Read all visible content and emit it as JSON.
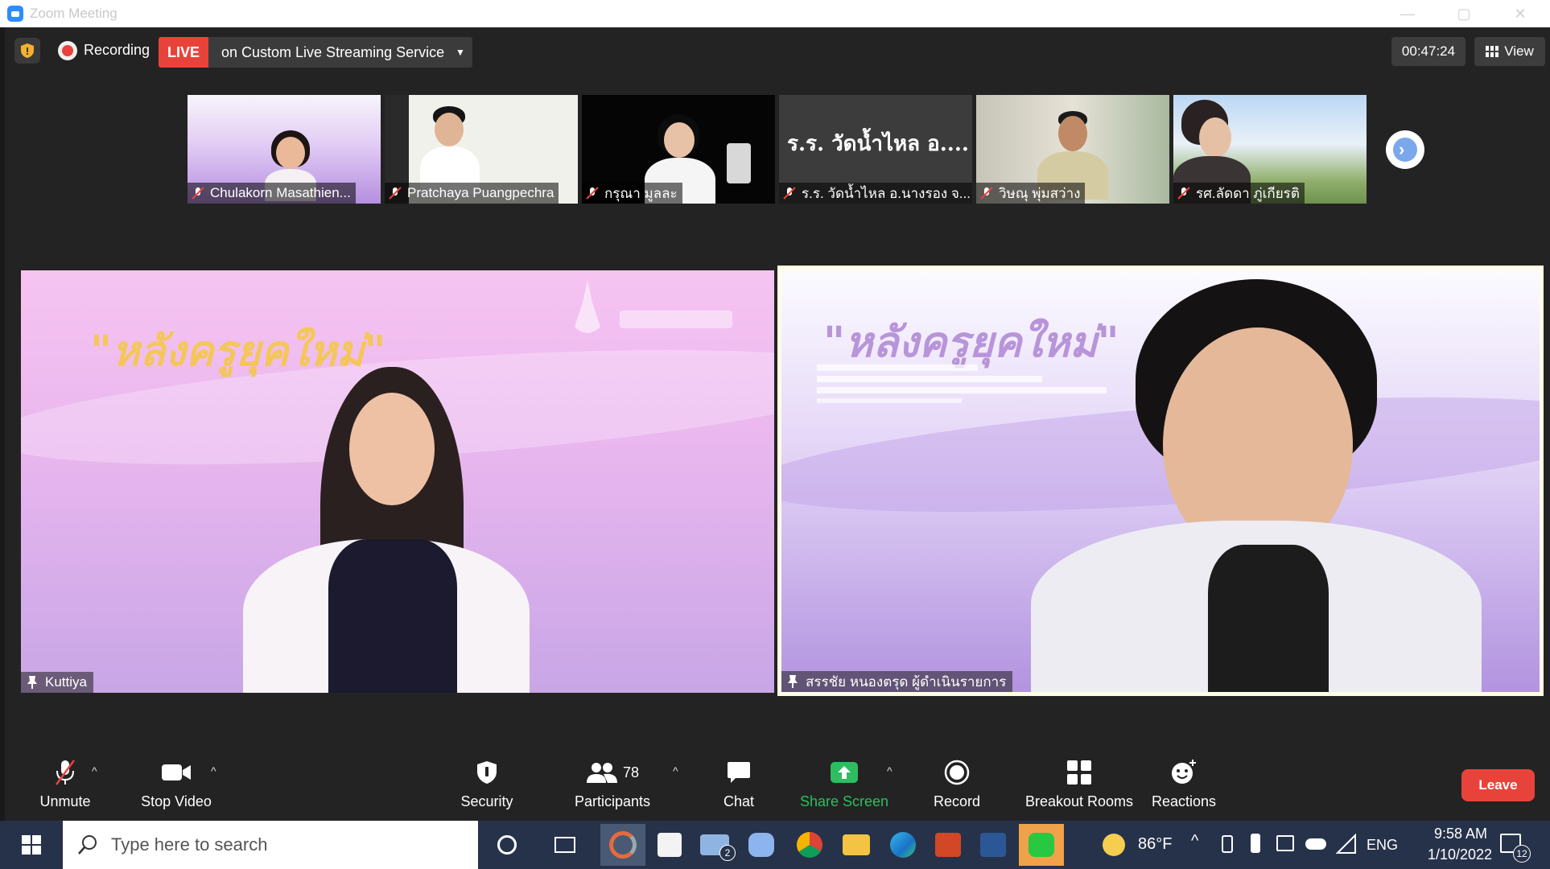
{
  "window": {
    "title": "Zoom Meeting",
    "controls": [
      "—",
      "▢",
      "✕"
    ]
  },
  "topbar": {
    "recording_label": "Recording",
    "live_tag": "LIVE",
    "live_service": "on Custom Live Streaming Service",
    "timer": "00:47:24",
    "view_label": "View"
  },
  "thumbnails": [
    {
      "name": "Chulakorn Masathien...",
      "bg": "#c9a5e6"
    },
    {
      "name": "Pratchaya Puangpechra",
      "bg": "#f2f2ee"
    },
    {
      "name": "กรุณา มูลละ",
      "bg": "#050505"
    },
    {
      "name": "ร.ร. วัดน้ำไหล อ.นางรอง จ...",
      "bg": "#3c3c3c",
      "tile_text": "ร.ร. วัดน้ำไหล อ...."
    },
    {
      "name": "วิษณุ พุ่มสว่าง",
      "bg": "#d8d4c8"
    },
    {
      "name": "รศ.ลัดดา ภู่เกียรติ",
      "bg": "#cfe1f2"
    }
  ],
  "main_tiles": {
    "left": {
      "name": "Kuttiya",
      "banner_title": "\"หลังครูยุคใหม่\""
    },
    "right": {
      "name": "สรรชัย หนองตรุด ผู้ดำเนินรายการ",
      "banner_title": "\"หลังครูยุคใหม่\""
    }
  },
  "toolbar": {
    "unmute": "Unmute",
    "stop_video": "Stop Video",
    "security": "Security",
    "participants": "Participants",
    "participants_count": "78",
    "chat": "Chat",
    "share_screen": "Share Screen",
    "record": "Record",
    "breakout_rooms": "Breakout Rooms",
    "reactions": "Reactions",
    "leave": "Leave"
  },
  "taskbar": {
    "search_placeholder": "Type here to search",
    "temperature": "86°F",
    "language": "ENG",
    "time": "9:58 AM",
    "date": "1/10/2022",
    "mail_badge": "2",
    "notification_badge": "12"
  },
  "colors": {
    "live_red": "#e8433b",
    "share_green": "#2ebd60",
    "meeting_bg": "#232323",
    "taskbar_bg": "#26324a"
  }
}
